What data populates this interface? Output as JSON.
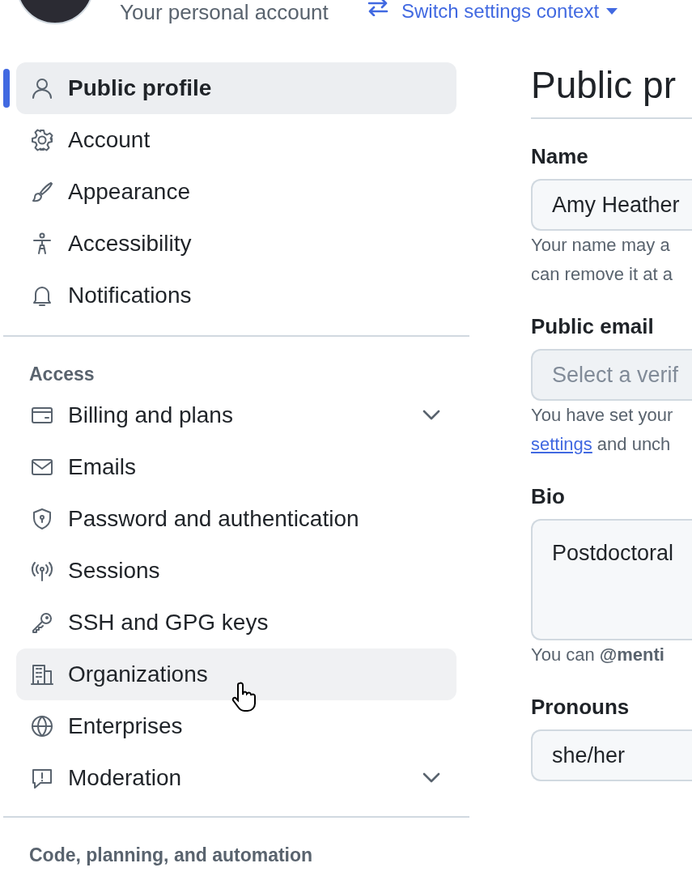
{
  "header": {
    "account_label": "Your personal account",
    "switch_link": "Switch settings context"
  },
  "sidebar": {
    "sections": [
      {
        "items": [
          {
            "label": "Public profile",
            "selected": true,
            "hovered": false,
            "expandable": false
          },
          {
            "label": "Account",
            "selected": false,
            "hovered": false,
            "expandable": false
          },
          {
            "label": "Appearance",
            "selected": false,
            "hovered": false,
            "expandable": false
          },
          {
            "label": "Accessibility",
            "selected": false,
            "hovered": false,
            "expandable": false
          },
          {
            "label": "Notifications",
            "selected": false,
            "hovered": false,
            "expandable": false
          }
        ]
      },
      {
        "heading": "Access",
        "items": [
          {
            "label": "Billing and plans",
            "selected": false,
            "hovered": false,
            "expandable": true
          },
          {
            "label": "Emails",
            "selected": false,
            "hovered": false,
            "expandable": false
          },
          {
            "label": "Password and authentication",
            "selected": false,
            "hovered": false,
            "expandable": false
          },
          {
            "label": "Sessions",
            "selected": false,
            "hovered": false,
            "expandable": false
          },
          {
            "label": "SSH and GPG keys",
            "selected": false,
            "hovered": false,
            "expandable": false
          },
          {
            "label": "Organizations",
            "selected": false,
            "hovered": true,
            "expandable": false
          },
          {
            "label": "Enterprises",
            "selected": false,
            "hovered": false,
            "expandable": false
          },
          {
            "label": "Moderation",
            "selected": false,
            "hovered": false,
            "expandable": true
          }
        ]
      },
      {
        "heading": "Code, planning, and automation"
      }
    ]
  },
  "main": {
    "title": "Public pr",
    "fields": [
      {
        "label": "Name",
        "kind": "input",
        "value": "Amy Heather",
        "help": [
          "Your name may a",
          "can remove it at a"
        ]
      },
      {
        "label": "Public email",
        "kind": "select",
        "placeholder": "Select a verif",
        "help": [
          "You have set your"
        ],
        "link": "settings",
        "after_link": "and unch"
      },
      {
        "label": "Bio",
        "kind": "textarea",
        "value": "Postdoctoral",
        "help": [
          "You can **@menti**"
        ]
      },
      {
        "label": "Pronouns",
        "kind": "input",
        "value": "she/her"
      }
    ]
  }
}
